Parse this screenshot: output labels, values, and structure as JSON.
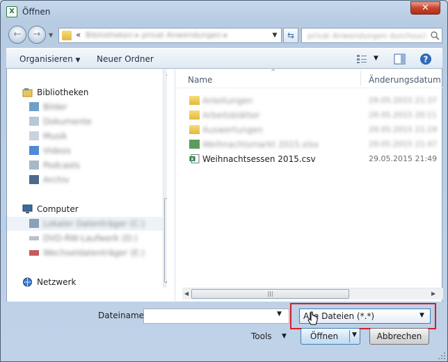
{
  "window": {
    "title": "Öffnen",
    "app_icon": "X",
    "close": "✕"
  },
  "navbar": {
    "back": "←",
    "forward": "→",
    "addr_sep": "«",
    "addr_path": "Bibliotheken ▸ privat Anwendungen ▸",
    "search_placeholder": "privat Anwendungen durchsuchen"
  },
  "toolbar": {
    "organize": "Organisieren",
    "new_folder": "Neuer Ordner"
  },
  "nav": {
    "libraries": "Bibliotheken",
    "library_items": [
      "Bilder",
      "Dokumente",
      "Musik",
      "Videos"
    ],
    "computer": "Computer",
    "computer_items": [
      "Lokaler Datenträger (C:)",
      "DVD-RW-Laufwerk (D:)",
      "Wechseldatenträger (E:)"
    ],
    "network": "Netzwerk"
  },
  "files": {
    "col_name": "Name",
    "col_date": "Änderungsdatum",
    "sort_indicator": "^",
    "rows": [
      {
        "name": "Anleitungen",
        "date": "29.05.2015 21:37",
        "type": "folder",
        "blurred": true
      },
      {
        "name": "Arbeitsblätter",
        "date": "29.05.2015 20:11",
        "type": "folder",
        "blurred": true
      },
      {
        "name": "Auswertungen",
        "date": "29.05.2015 21:19",
        "type": "folder",
        "blurred": true
      },
      {
        "name": "Weihnachtsmarkt 2015.xlsx",
        "date": "29.05.2015 21:47",
        "type": "xlsx",
        "blurred": true
      },
      {
        "name": "Weihnachtsessen 2015.csv",
        "date": "29.05.2015 21:49",
        "type": "csv",
        "blurred": false
      }
    ]
  },
  "bottom": {
    "filename_label": "Dateiname:",
    "filename_value": "",
    "filter_value": "Alle Dateien (*.*)",
    "tools": "Tools",
    "open": "Öffnen",
    "cancel": "Abbrechen"
  },
  "colors": {
    "highlight_box": "#d21f26",
    "selection_border": "#3c7fb1"
  }
}
